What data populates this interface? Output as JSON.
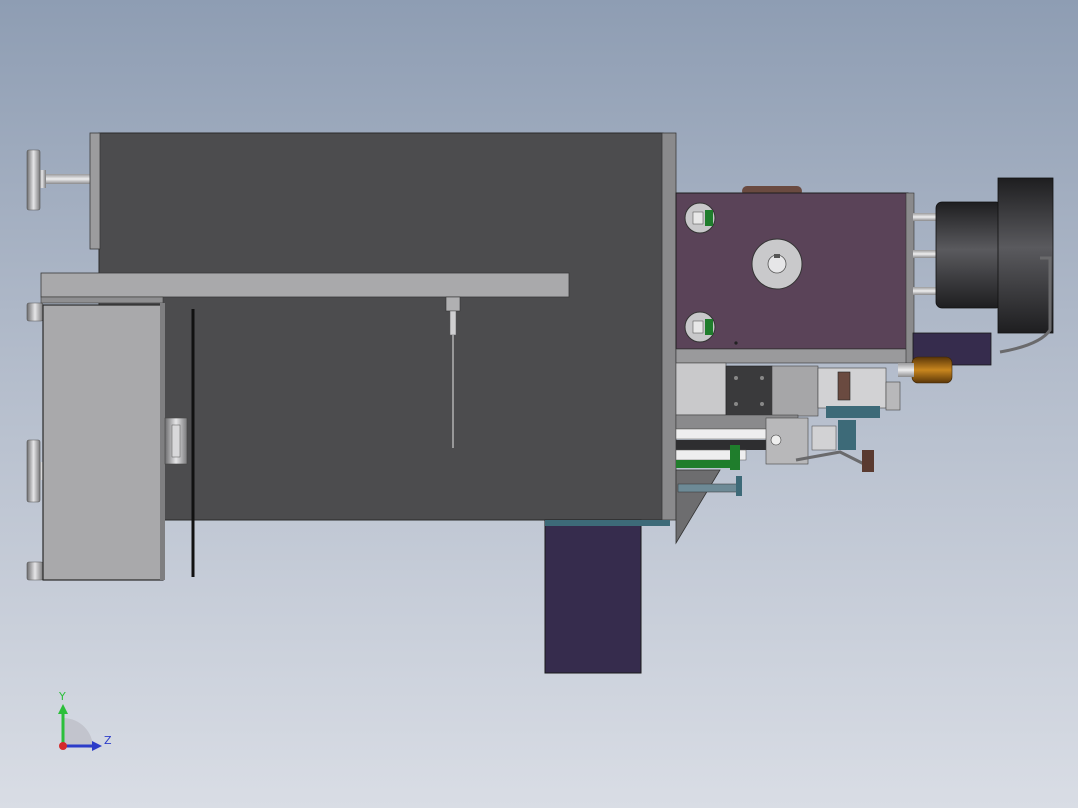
{
  "triad": {
    "y_label": "Y",
    "z_label": "Z",
    "y_color": "#2bbf3a",
    "z_color": "#2c3cc9",
    "x_color": "#d42a2a"
  },
  "colors": {
    "main_body": "#4c4c4e",
    "side_panel": "#a9a9ab",
    "head_block": "#5a4358",
    "lower_block": "#362c4d",
    "dark_cylinder": "#2e2e30",
    "accent_green": "#1f7d2c",
    "brass": "#a66a12"
  }
}
